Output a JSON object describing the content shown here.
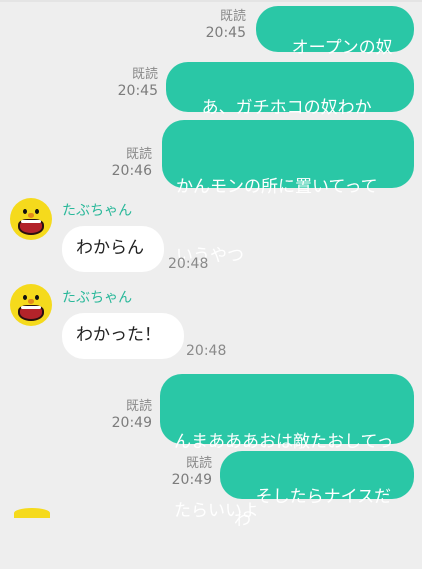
{
  "read_label": "既読",
  "sender_name": "たぶちゃん",
  "messages": [
    {
      "side": "me",
      "text": "オープンの奴で",
      "time": "20:45",
      "read": true
    },
    {
      "side": "me",
      "text": "あ、ガチホコの奴わかる？",
      "time": "20:45",
      "read": true
    },
    {
      "side": "me",
      "lines": [
        "かんモンの所に置いてって",
        "いうやつ"
      ],
      "time": "20:46",
      "read": true
    },
    {
      "side": "them",
      "sender": "たぶちゃん",
      "text": "わからん",
      "time": "20:48"
    },
    {
      "side": "them",
      "sender": "たぶちゃん",
      "text": "わかった！",
      "time": "20:48"
    },
    {
      "side": "me",
      "lines": [
        "んまあああおは敵たおしてっ",
        "たらいいよ"
      ],
      "time": "20:49",
      "read": true
    },
    {
      "side": "me",
      "text": "そしたらナイスだわ",
      "time": "20:49",
      "read": true
    }
  ],
  "colors": {
    "my_bubble": "#2ac7a6",
    "their_bubble": "#ffffff",
    "sender_name": "#2ab89a",
    "background": "#eeeeee"
  },
  "icons": {
    "avatar": "yellow-bird-avatar-icon"
  }
}
